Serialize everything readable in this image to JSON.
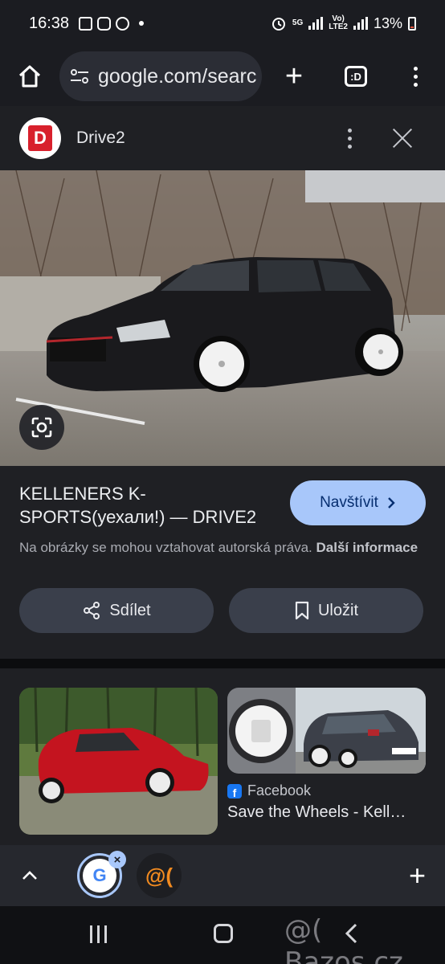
{
  "status_bar": {
    "time": "16:38",
    "network_5g": "5G",
    "volte_top": "Vo)",
    "volte_bottom": "LTE2",
    "battery_percent": "13%",
    "battery_level": 0.13,
    "icons": [
      "gallery-icon",
      "instagram-icon",
      "messenger-icon",
      "alarm-icon",
      "signal-icon",
      "battery-icon"
    ]
  },
  "browser": {
    "url": "google.com/searc",
    "tab_count_label": ":D"
  },
  "result": {
    "site_logo_letter": "D",
    "site_name": "Drive2",
    "title": "KELLENERS K-SPORTS(уехали!) — DRIVE2",
    "visit_label": "Navštívit",
    "copyright_text": "Na obrázky se mohou vztahovat autorská práva.",
    "more_info_label": "Další informace",
    "share_label": "Sdílet",
    "save_label": "Uložit"
  },
  "related": {
    "source_icon_letter": "f",
    "source_name": "Facebook",
    "title": "Save the Wheels - Kell…"
  },
  "tab_strip": {
    "active_tab_letter": "G",
    "close_badge": "×",
    "other_tab_letter": "@("
  },
  "nav_bar": {
    "watermark": "@( Bazos.cz"
  },
  "colors": {
    "accent": "#a8c7fa",
    "panel_bg": "#1f2024",
    "button_bg": "#3a3f4b",
    "drive2_red": "#d8202c"
  }
}
